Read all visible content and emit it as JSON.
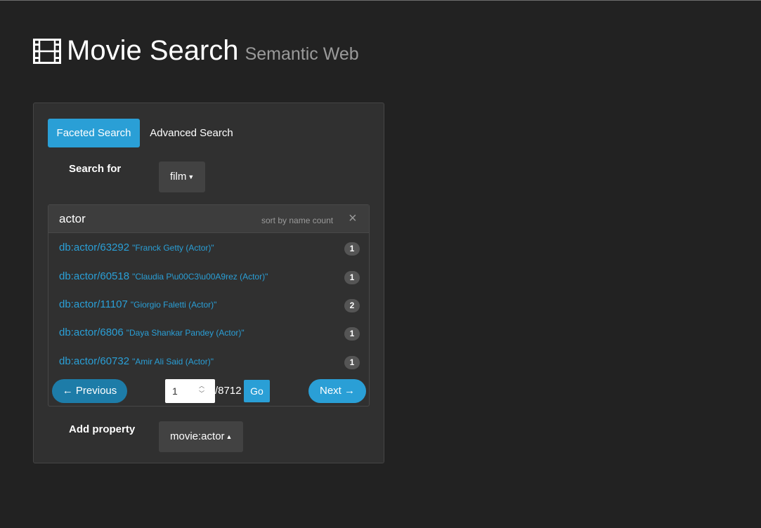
{
  "header": {
    "title": "Movie Search",
    "subtitle": "Semantic Web",
    "icon": "film-icon"
  },
  "tabs": [
    {
      "label": "Faceted Search",
      "active": true
    },
    {
      "label": "Advanced Search",
      "active": false
    }
  ],
  "search_for": {
    "label": "Search for",
    "value": "film"
  },
  "facet": {
    "title": "actor",
    "sort_prefix": "sort by",
    "sort_name": "name",
    "sort_count": "count",
    "close_symbol": "×",
    "items": [
      {
        "id": "db:actor/63292",
        "label": "\"Franck Getty (Actor)\"",
        "count": "1"
      },
      {
        "id": "db:actor/60518",
        "label": "\"Claudia P\\u00C3\\u00A9rez (Actor)\"",
        "count": "1"
      },
      {
        "id": "db:actor/11107",
        "label": "\"Giorgio Faletti (Actor)\"",
        "count": "2"
      },
      {
        "id": "db:actor/6806",
        "label": "\"Daya Shankar Pandey (Actor)\"",
        "count": "1"
      },
      {
        "id": "db:actor/60732",
        "label": "\"Amir Ali Said (Actor)\"",
        "count": "1"
      }
    ]
  },
  "pager": {
    "previous_label": "← Previous",
    "next_label": "Next →",
    "current_page": "1",
    "total_pages": "/8712",
    "go_label": "Go"
  },
  "add_property": {
    "label": "Add property",
    "value": "movie:actor"
  },
  "colors": {
    "background": "#222222",
    "panel": "#303030",
    "accent": "#2a9fd6"
  }
}
